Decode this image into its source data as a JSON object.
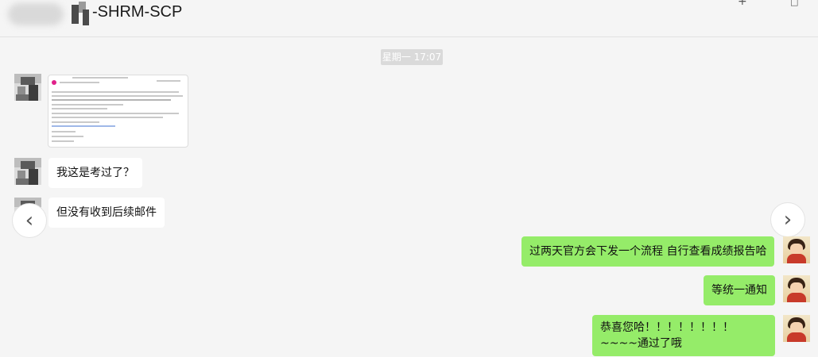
{
  "header": {
    "title": "-SHRM-SCP",
    "add_icon": "+",
    "more_icon": "□"
  },
  "timestamp": "星期一 17:07",
  "messages": [
    {
      "side": "in",
      "type": "image",
      "image_name": "email-screenshot"
    },
    {
      "side": "in",
      "type": "text",
      "text": "我这是考过了？"
    },
    {
      "side": "in",
      "type": "text",
      "text": "但没有收到后续邮件"
    },
    {
      "side": "out",
      "type": "text",
      "text": "过两天官方会下发一个流程 自行查看成绩报告哈"
    },
    {
      "side": "out",
      "type": "text",
      "text": "等统一通知"
    },
    {
      "side": "out",
      "type": "text",
      "text": "恭喜您哈！！！！！！！！ ~~~~通过了哦"
    }
  ],
  "nav": {
    "prev_icon": "‹",
    "next_icon": "›"
  },
  "colors": {
    "background": "#f5f5f5",
    "incoming_bubble": "#ffffff",
    "outgoing_bubble": "#95ec69",
    "timestamp_bg": "#dadada"
  }
}
